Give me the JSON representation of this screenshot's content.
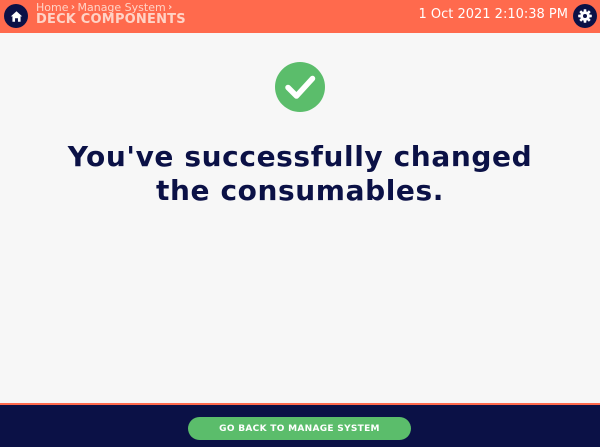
{
  "header": {
    "breadcrumb": [
      "Home",
      "Manage System"
    ],
    "title": "DECK COMPONENTS",
    "datetime": "1 Oct 2021 2:10:38 PM"
  },
  "icons": {
    "home": "home-icon",
    "settings": "gear-icon",
    "success": "check-circle-icon"
  },
  "colors": {
    "header": "#ff6a4d",
    "navy": "#0b1146",
    "success": "#5bbd6b",
    "background": "#f7f7f7"
  },
  "main": {
    "message_lines": [
      "You've successfully changed",
      "the consumables."
    ]
  },
  "footer": {
    "back_button_label": "GO BACK TO MANAGE SYSTEM"
  }
}
